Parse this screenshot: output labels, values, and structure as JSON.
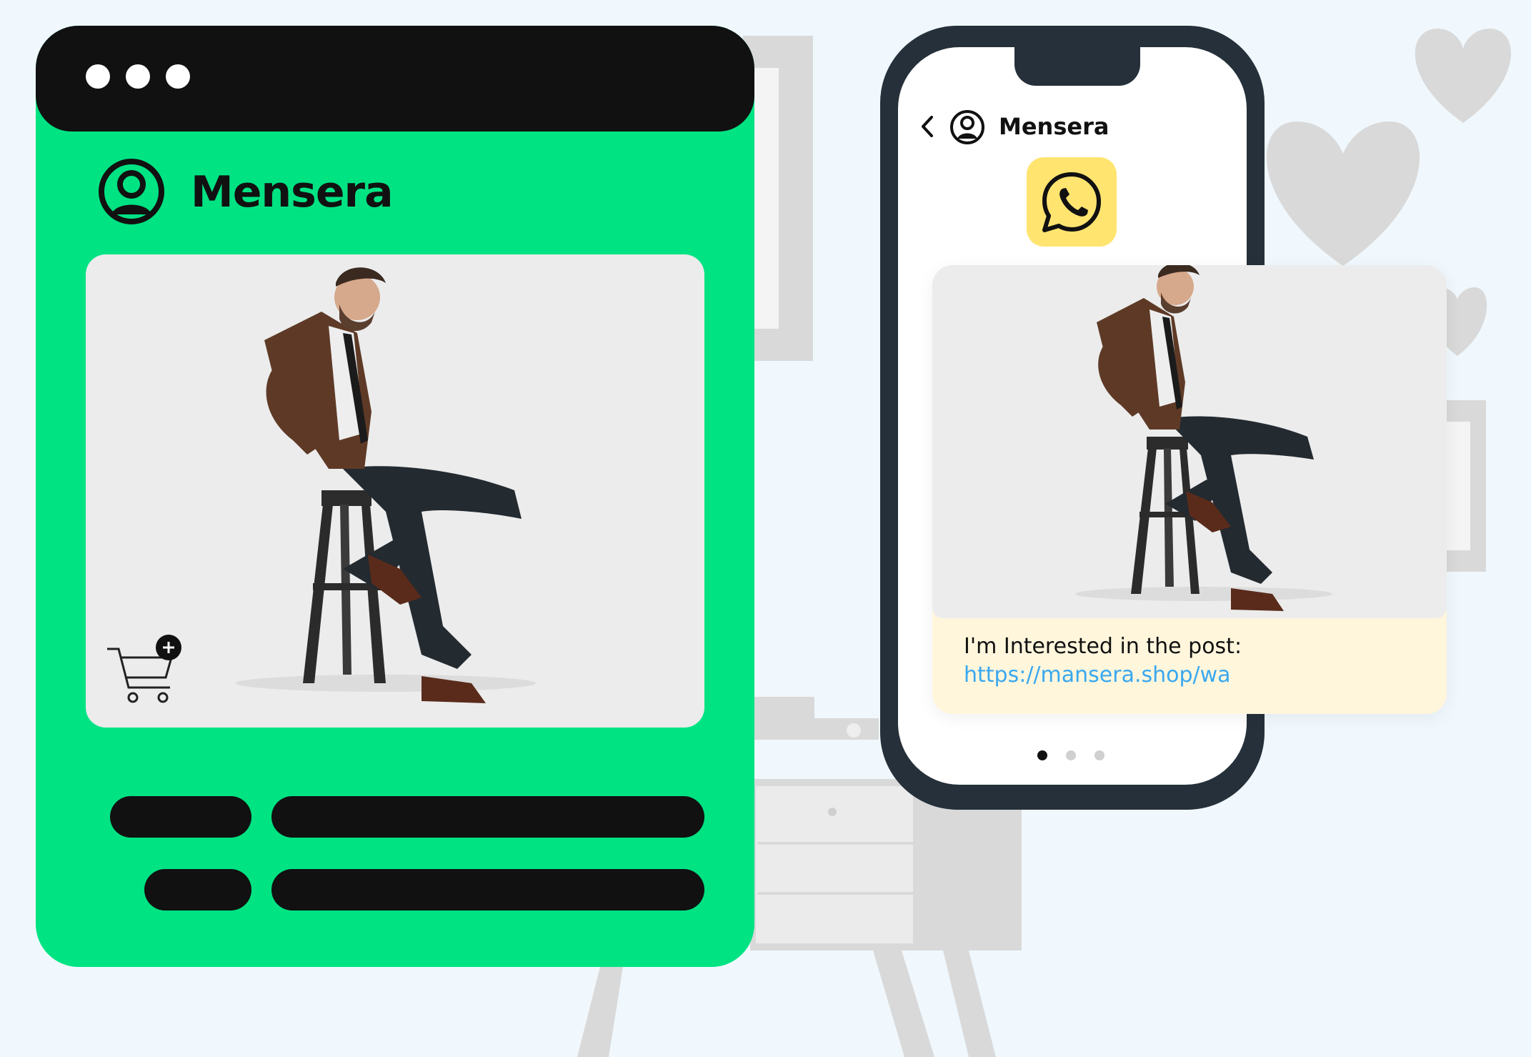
{
  "browser": {
    "window_controls": [
      "dot",
      "dot",
      "dot"
    ],
    "profile_name": "Mensera",
    "cart_icon": "cart-plus-icon",
    "placeholder_bars": 4
  },
  "phone": {
    "back_icon": "chevron-left-icon",
    "profile_name": "Mensera",
    "app_icon": "whatsapp-icon",
    "message": {
      "text": "I'm Interested in the post:",
      "link": "https://mansera.shop/wa"
    },
    "pager": {
      "total": 3,
      "active": 1
    }
  },
  "colors": {
    "browser_bg": "#00e383",
    "dark": "#111111",
    "phone_frame": "#25303a",
    "whatsapp_tile": "#ffe470",
    "message_bg": "#fff6dc",
    "link": "#39a8ef"
  }
}
